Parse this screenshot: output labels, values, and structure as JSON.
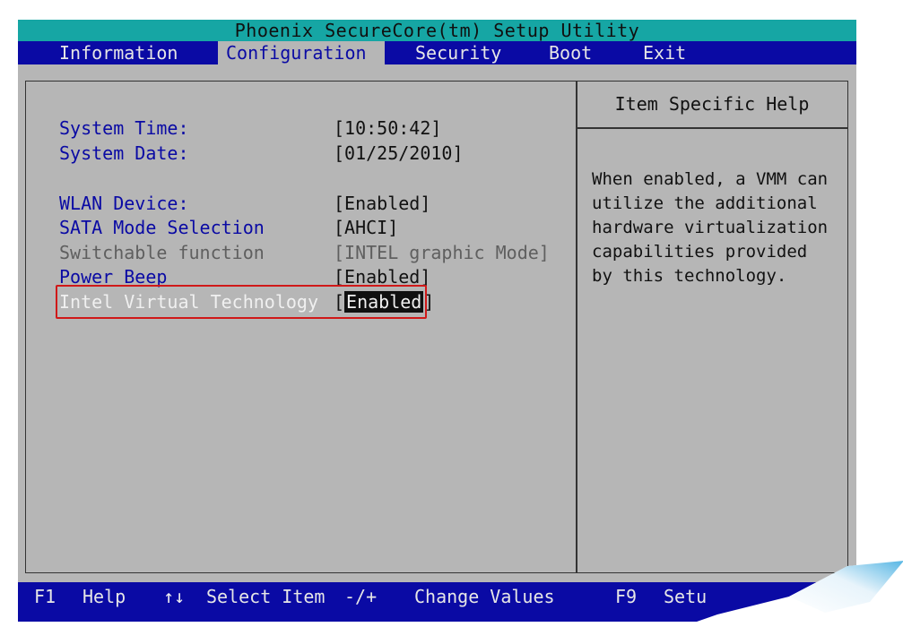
{
  "title": "Phoenix SecureCore(tm) Setup Utility",
  "tabs": [
    "Information",
    "Configuration",
    "Security",
    "Boot",
    "Exit"
  ],
  "active_tab": "Configuration",
  "settings": [
    {
      "label": "System Time:",
      "value": "[10:50:42]"
    },
    {
      "label": "System Date:",
      "value": "[01/25/2010]"
    },
    {
      "label": "WLAN Device:",
      "value": "[Enabled]"
    },
    {
      "label": "SATA Mode Selection",
      "value": "[AHCI]"
    },
    {
      "label": "Switchable function",
      "value": "[INTEL graphic Mode]",
      "disabled": true
    },
    {
      "label": "Power Beep",
      "value": "[Enabled]"
    },
    {
      "label": "Intel Virtual Technology",
      "value_prefix": "[",
      "value": "Enabled",
      "value_suffix": "]",
      "selected": true
    }
  ],
  "help": {
    "title": "Item Specific Help",
    "text": "When enabled, a VMM can\nutilize the additional\nhardware virtualization\ncapabilities provided\nby this technology."
  },
  "bottom_bar": {
    "f1": "F1",
    "help": "Help",
    "arrows": "↑↓",
    "select_item": "Select Item",
    "plus_minus": "-/+",
    "change_values": "Change Values",
    "f9": "F9",
    "setup": "Setu"
  },
  "colors": {
    "title_bg": "#16a6a4",
    "menu_bg": "#0a0aa4",
    "panel_bg": "#b6b6b6",
    "highlight_box": "#d01818"
  }
}
